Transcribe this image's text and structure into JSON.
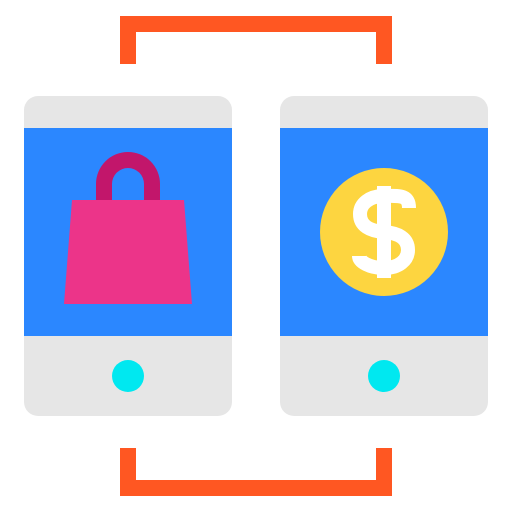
{
  "icon": {
    "left_device": {
      "content_icon": "shopping-bag-icon"
    },
    "right_device": {
      "content_icon": "dollar-coin-icon",
      "symbol": "$"
    },
    "connector": {
      "icon": "bracket-connector-icon"
    }
  },
  "colors": {
    "bracket": "#FF5722",
    "device_body": "#E6E6E6",
    "screen": "#2B87FF",
    "home_button": "#00E8F0",
    "bag_body": "#EC3489",
    "bag_handle": "#C2166B",
    "coin": "#FDD540",
    "coin_symbol": "#FFFFFF"
  }
}
